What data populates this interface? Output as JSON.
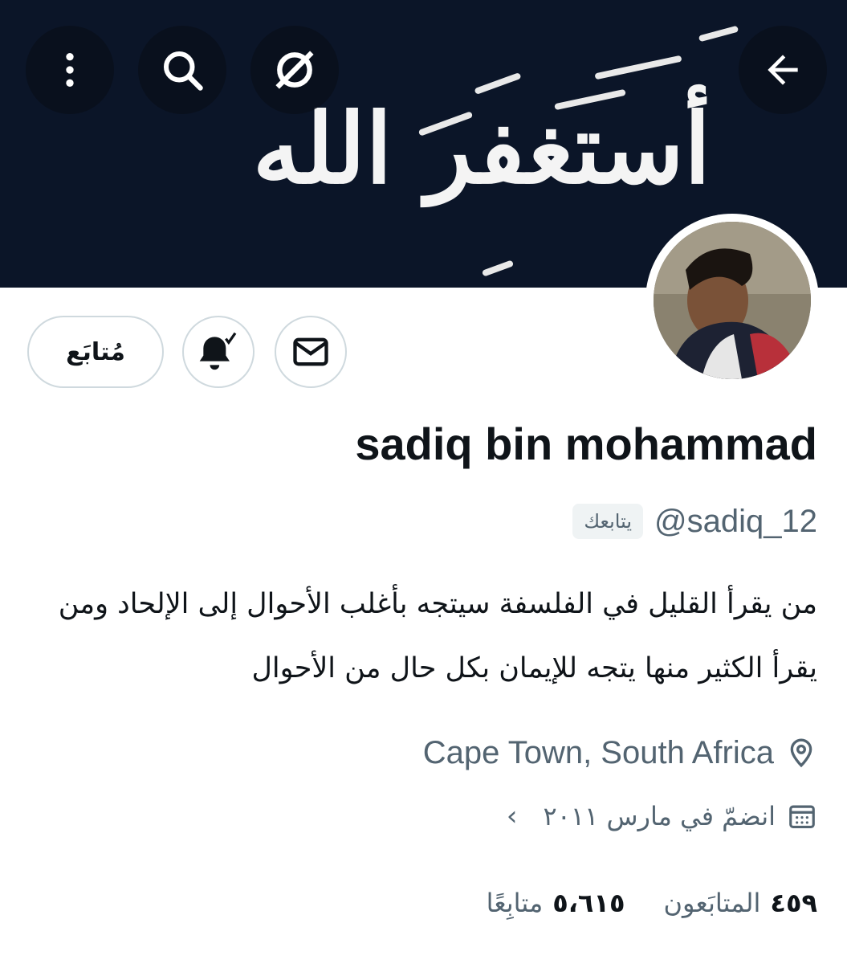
{
  "banner": {
    "calligraphy_text": "أستغفر الله"
  },
  "top_bar": {
    "back_icon": "arrow-left-icon",
    "grok_icon": "grok-icon",
    "search_icon": "search-icon",
    "more_icon": "more-vertical-icon"
  },
  "actions": {
    "follow_label": "مُتابَع",
    "notifications_icon": "bell-check-icon",
    "message_icon": "mail-icon"
  },
  "profile": {
    "name": "sadiq bin mohammad",
    "handle": "@sadiq_12",
    "follows_you": "يتابعك",
    "bio_line1": "من يقرأ القليل في الفلسفة سيتجه بأغلب الأحوال إلى الإلحاد ومن",
    "bio_line2": "يقرأ الكثير منها يتجه للإيمان بكل حال من الأحوال",
    "location": "Cape Town, South Africa",
    "joined": "انضمّ في مارس ٢٠١١"
  },
  "stats": {
    "followers_count": "٤٥٩",
    "followers_label": "المتابَعون",
    "following_count": "٥،٦١٥",
    "following_label": "متابِعًا"
  },
  "colors": {
    "secondary_text": "#536471",
    "primary_text": "#0f1419",
    "border": "#cfd9de",
    "banner_bg": "#0b1528"
  }
}
